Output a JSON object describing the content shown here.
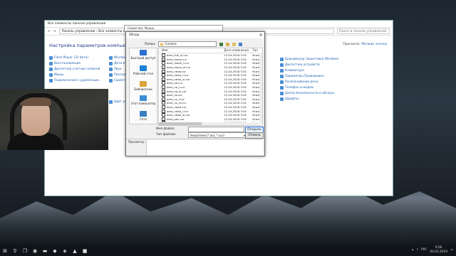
{
  "control_panel": {
    "title": "Все элементы панели управления",
    "breadcrumb": "Панель управления  ›  Все элементы панели управления",
    "search_placeholder": "Поиск в панели управления",
    "heading": "Настройка параметров компьютера",
    "view_label": "Просмотр:",
    "view_value": "Мелкие значки",
    "col1": [
      "Flash Player (32 бита)",
      "Восстановление",
      "Диспетчер учетных записей",
      "Мышь",
      "Подключения к удаленным..."
    ],
    "col2": [
      "Windows ...",
      "Дата и время",
      "Звук",
      "Програм...",
      "Свойства...",
      "Цвет управления"
    ],
    "col3": [
      "Брандмауэр Защитника Windows",
      "Диспетчер устройств",
      "Клавиатура",
      "Параметры Проводника",
      "Распознавание речи",
      "Телефон и модем",
      "Центр безопасности и обслуж...",
      "Шрифты"
    ]
  },
  "properties_title": "Свойства: Мышь",
  "dialog": {
    "title": "Обзор",
    "folder_label": "Папка:",
    "folder_value": "Cursors",
    "columns": [
      "Имя",
      "Дата изменения",
      "Тип"
    ],
    "files": [
      {
        "name": "aero_link_xl.cur",
        "date": "12.04.2018 3:34",
        "type": "Указат"
      },
      {
        "name": "aero_move.cur",
        "date": "12.04.2018 3:34",
        "type": "Указат"
      },
      {
        "name": "aero_move_l.cur",
        "date": "12.04.2018 3:34",
        "type": "Указат"
      },
      {
        "name": "aero_move_xl.cur",
        "date": "12.04.2018 3:34",
        "type": "Указат"
      },
      {
        "name": "aero_nesw.cur",
        "date": "12.04.2018 3:34",
        "type": "Указат"
      },
      {
        "name": "aero_nesw_l.cur",
        "date": "12.04.2018 3:34",
        "type": "Указат"
      },
      {
        "name": "aero_nesw_xl.cur",
        "date": "12.04.2018 3:34",
        "type": "Указат"
      },
      {
        "name": "aero_no.cur",
        "date": "12.04.2018 3:34",
        "type": "Указат"
      },
      {
        "name": "aero_no_l.cur",
        "date": "12.04.2018 3:34",
        "type": "Указат"
      },
      {
        "name": "aero_no_xl.cur",
        "date": "12.04.2018 3:34",
        "type": "Указат"
      },
      {
        "name": "aero_ns.cur",
        "date": "12.04.2018 3:34",
        "type": "Указат"
      },
      {
        "name": "aero_ns_l.cur",
        "date": "12.04.2018 3:34",
        "type": "Указат"
      },
      {
        "name": "aero_ns_xl.cur",
        "date": "12.04.2018 3:34",
        "type": "Указат"
      },
      {
        "name": "aero_nwse.cur",
        "date": "12.04.2018 3:34",
        "type": "Указат"
      },
      {
        "name": "aero_nwse_l.cur",
        "date": "12.04.2018 3:34",
        "type": "Указат"
      },
      {
        "name": "aero_nwse_xl.cur",
        "date": "12.04.2018 3:34",
        "type": "Указат"
      },
      {
        "name": "aero_pen.cur",
        "date": "12.04.2018 3:34",
        "type": "Указат"
      },
      {
        "name": "aero_pen_l.cur",
        "date": "12.04.2018 3:34",
        "type": "Указат"
      }
    ],
    "places": [
      "Быстрый доступ",
      "Рабочий стол",
      "Библиотеки",
      "Этот компьютер",
      "Сеть"
    ],
    "filename_label": "Имя файла:",
    "filename_value": "",
    "filetype_label": "Тип файлов:",
    "filetype_value": "Указатели (*.ani, *.cur)",
    "open_button": "Открыть",
    "cancel_button": "Отмена",
    "preview_label": "Просмотр:"
  },
  "tray": {
    "lang": "РУС",
    "time": "0:00",
    "date": "03.01.2019"
  },
  "colors": {
    "accent": "#1e5fb4",
    "dialog_bg": "#f0f0f0",
    "taskbar": "#101418"
  }
}
